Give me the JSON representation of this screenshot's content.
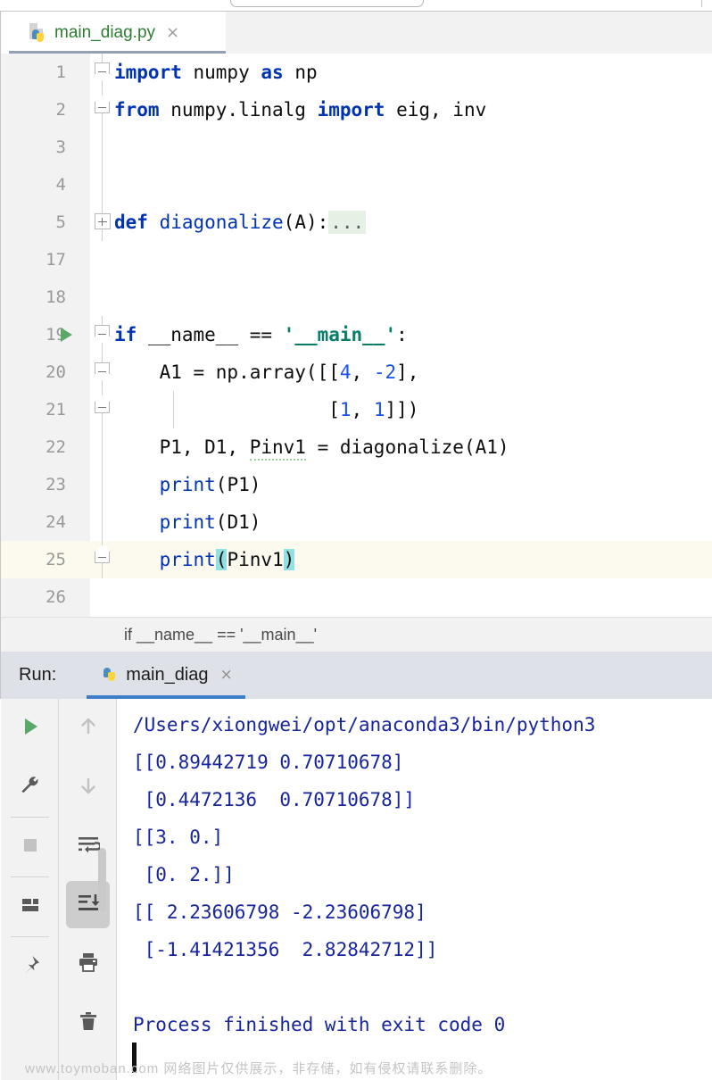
{
  "window": {
    "ide": "PyCharm"
  },
  "editor_tab": {
    "filename": "main_diag.py",
    "icon": "python-file-icon",
    "close_label": "×",
    "title_color": "#2e7d32"
  },
  "code": {
    "lines": [
      {
        "number": "1",
        "fold": "collapse-top",
        "text": "import numpy as np"
      },
      {
        "number": "2",
        "fold": "collapse-bottom",
        "text": "from numpy.linalg import eig, inv"
      },
      {
        "number": "3",
        "fold": "none",
        "text": ""
      },
      {
        "number": "4",
        "fold": "none",
        "text": ""
      },
      {
        "number": "5",
        "fold": "expand",
        "text": "def diagonalize(A):..."
      },
      {
        "number": "17",
        "fold": "none",
        "text": ""
      },
      {
        "number": "18",
        "fold": "none",
        "text": ""
      },
      {
        "number": "19",
        "fold": "collapse-top",
        "text": "if __name__ == '__main__':",
        "run_marker": true
      },
      {
        "number": "20",
        "fold": "collapse-top",
        "text": "    A1 = np.array([[4, -2],"
      },
      {
        "number": "21",
        "fold": "collapse-bottom",
        "text": "                   [1, 1]])"
      },
      {
        "number": "22",
        "fold": "none",
        "text": "    P1, D1, Pinv1 = diagonalize(A1)"
      },
      {
        "number": "23",
        "fold": "none",
        "text": "    print(P1)"
      },
      {
        "number": "24",
        "fold": "none",
        "text": "    print(D1)"
      },
      {
        "number": "25",
        "fold": "collapse-bottom",
        "text": "    print(Pinv1)",
        "current": true
      },
      {
        "number": "26",
        "fold": "none",
        "text": ""
      }
    ]
  },
  "breadcrumb": {
    "text": "if __name__ == '__main__'"
  },
  "run_panel": {
    "label": "Run:",
    "tab_name": "main_diag",
    "tab_icon": "python-icon",
    "tab_close_label": "×",
    "accent_color": "#3e7ecb",
    "toolbar_left": [
      {
        "name": "rerun-button",
        "icon": "play-icon",
        "active": false
      },
      {
        "name": "modify-run-config",
        "icon": "wrench-icon",
        "active": false
      },
      {
        "name": "stop-button",
        "icon": "stop-square-icon",
        "active": false
      },
      {
        "name": "layout-settings",
        "icon": "layout-icon",
        "active": false
      },
      {
        "name": "pin-tab-button",
        "icon": "pin-icon",
        "active": false
      }
    ],
    "toolbar_right": [
      {
        "name": "previous-occurrence",
        "icon": "arrow-up-icon",
        "active": false
      },
      {
        "name": "next-occurrence",
        "icon": "arrow-down-icon",
        "active": false
      },
      {
        "name": "soft-wrap-toggle",
        "icon": "soft-wrap-icon",
        "active": false
      },
      {
        "name": "scroll-to-end",
        "icon": "scroll-end-icon",
        "active": true
      },
      {
        "name": "print-button",
        "icon": "printer-icon",
        "active": false
      },
      {
        "name": "clear-all-button",
        "icon": "trash-icon",
        "active": false
      }
    ],
    "console_lines": [
      "/Users/xiongwei/opt/anaconda3/bin/python3",
      "[[0.89442719 0.70710678]",
      " [0.4472136  0.70710678]]",
      "[[3. 0.]",
      " [0. 2.]]",
      "[[ 2.23606798 -2.23606798]",
      " [-1.41421356  2.82842712]]",
      "",
      "Process finished with exit code 0"
    ],
    "text_color": "#17249e"
  },
  "watermark": {
    "text": "www.toymoban.com  网络图片仅供展示，非存储，如有侵权请联系删除。"
  }
}
